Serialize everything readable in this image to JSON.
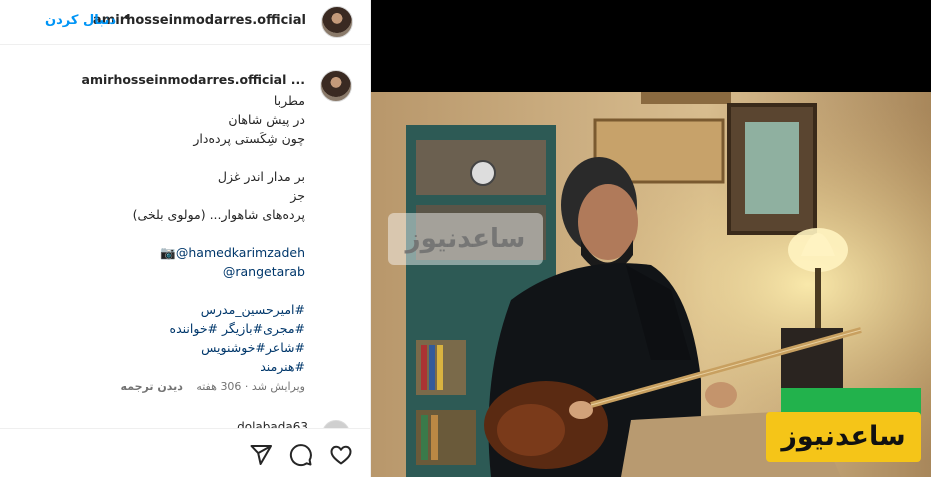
{
  "header": {
    "username": "amirhosseinmodarres.official",
    "dot": "•",
    "follow_label": "دنبال کردن"
  },
  "caption": {
    "username": "amirhosseinmodarres.official ...",
    "lines": [
      "مطربا",
      "در پیش شاهان",
      "چون شِکَستی پرده‌دار",
      "",
      "بر مدار اندر غزل",
      "جز",
      "پرده‌های شاهوار... (مولوی بلخی)",
      ""
    ],
    "mention1": "📷@hamedkarimzadeh",
    "mention2": "@rangetarab",
    "hashtags": [
      "#امیرحسین_مدرس",
      "#مجری#بازیگر #خواننده",
      "#شاعر#خوشنویس",
      "#هنرمند"
    ]
  },
  "meta": {
    "edited": "ویرایش شد · 306 هفته",
    "see_translation": "دیدن ترجمه"
  },
  "comment": {
    "preview": "dolabada63 ..."
  },
  "actions": {
    "like_icon": "heart-icon",
    "comment_icon": "comment-icon",
    "share_icon": "paper-plane-icon"
  },
  "media": {
    "watermark_center": "ساعدنیوز",
    "watermark_brand": "ساعدنیوز",
    "brand_green": "#22b24c",
    "brand_yellow": "#f5c518"
  }
}
